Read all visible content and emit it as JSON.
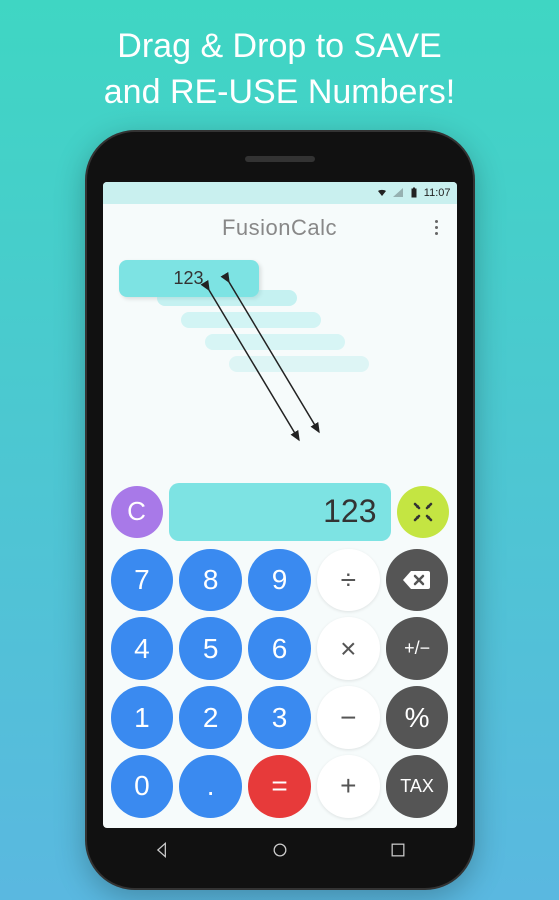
{
  "promo": {
    "line1": "Drag & Drop to SAVE",
    "line2": "and RE-USE Numbers!"
  },
  "status": {
    "time": "11:07"
  },
  "app": {
    "title": "FusionCalc"
  },
  "memo": {
    "saved_value": "123"
  },
  "display": {
    "value": "123"
  },
  "buttons": {
    "clear": "C",
    "equals": "=",
    "divide": "÷",
    "multiply": "×",
    "plus": "+",
    "minus": "−",
    "dot": ".",
    "plusminus": "+/−",
    "percent": "%",
    "tax": "TAX"
  },
  "keys": {
    "k0": "0",
    "k1": "1",
    "k2": "2",
    "k3": "3",
    "k4": "4",
    "k5": "5",
    "k6": "6",
    "k7": "7",
    "k8": "8",
    "k9": "9"
  }
}
